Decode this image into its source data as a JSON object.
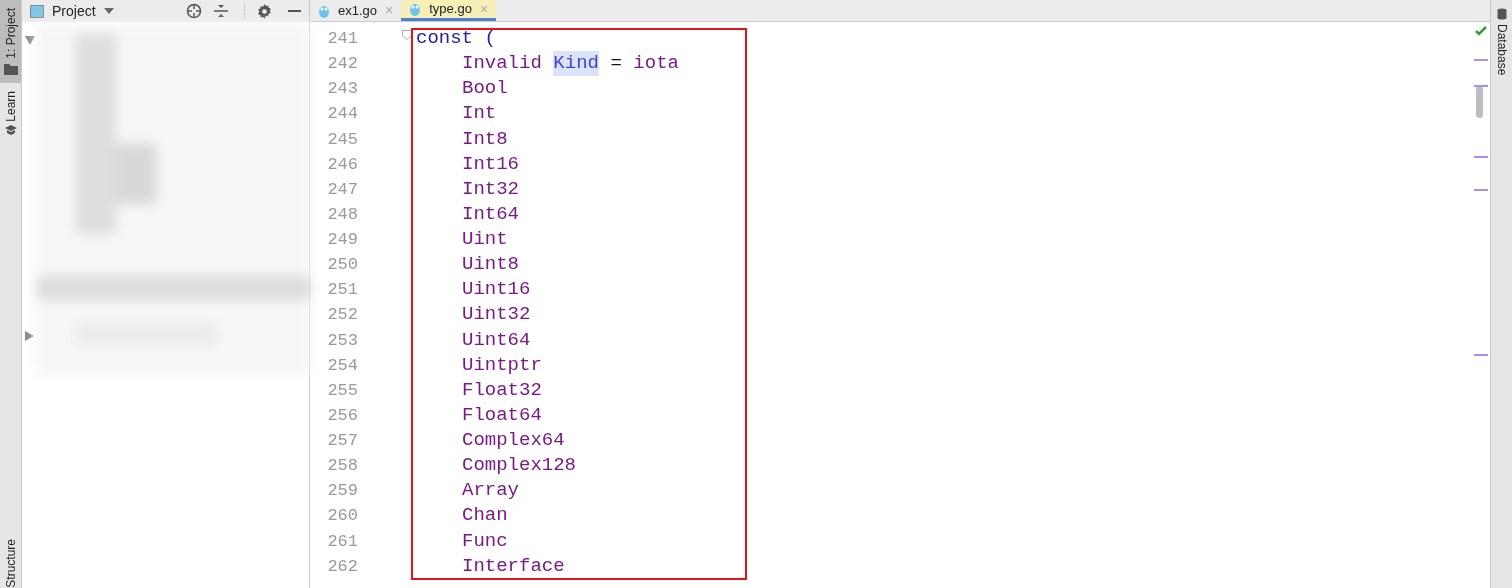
{
  "left_stripe": {
    "tabs": [
      {
        "label": "1: Project",
        "selected": true,
        "kind": "folder"
      },
      {
        "label": "Learn",
        "selected": false,
        "kind": "learn"
      }
    ],
    "bottom_tabs": [
      {
        "label": "Structure",
        "selected": false
      }
    ]
  },
  "project_panel": {
    "title": "Project",
    "tree_nodes": [
      {
        "expanded": true
      },
      {
        "expanded": false
      }
    ]
  },
  "editor_tabs": [
    {
      "label": "ex1.go",
      "close": "×",
      "selected": false
    },
    {
      "label": "type.go",
      "close": "×",
      "selected": true
    }
  ],
  "code": [
    {
      "number": "241",
      "segments": [
        {
          "text": "const (",
          "kind": "keyword"
        }
      ],
      "children": [
        {
          "number": "242",
          "segments": [
            {
              "text": "Invalid",
              "kind": "constant"
            },
            {
              "text": "Kind",
              "kind": "highlighted"
            },
            {
              "text": "=",
              "kind": "plain"
            },
            {
              "text": "iota",
              "kind": "constant"
            }
          ]
        },
        {
          "number": "243",
          "segments": [
            {
              "text": "Bool",
              "kind": "constant"
            }
          ]
        },
        {
          "number": "244",
          "segments": [
            {
              "text": "Int",
              "kind": "constant"
            }
          ]
        },
        {
          "number": "245",
          "segments": [
            {
              "text": "Int8",
              "kind": "constant"
            }
          ]
        },
        {
          "number": "246",
          "segments": [
            {
              "text": "Int16",
              "kind": "constant"
            }
          ]
        },
        {
          "number": "247",
          "segments": [
            {
              "text": "Int32",
              "kind": "constant"
            }
          ]
        },
        {
          "number": "248",
          "segments": [
            {
              "text": "Int64",
              "kind": "constant"
            }
          ]
        },
        {
          "number": "249",
          "segments": [
            {
              "text": "Uint",
              "kind": "constant"
            }
          ]
        },
        {
          "number": "250",
          "segments": [
            {
              "text": "Uint8",
              "kind": "constant"
            }
          ]
        },
        {
          "number": "251",
          "segments": [
            {
              "text": "Uint16",
              "kind": "constant"
            }
          ]
        },
        {
          "number": "252",
          "segments": [
            {
              "text": "Uint32",
              "kind": "constant"
            }
          ]
        },
        {
          "number": "253",
          "segments": [
            {
              "text": "Uint64",
              "kind": "constant"
            }
          ]
        },
        {
          "number": "254",
          "segments": [
            {
              "text": "Uintptr",
              "kind": "constant"
            }
          ]
        },
        {
          "number": "255",
          "segments": [
            {
              "text": "Float32",
              "kind": "constant"
            }
          ]
        },
        {
          "number": "256",
          "segments": [
            {
              "text": "Float64",
              "kind": "constant"
            }
          ]
        },
        {
          "number": "257",
          "segments": [
            {
              "text": "Complex64",
              "kind": "constant"
            }
          ]
        },
        {
          "number": "258",
          "segments": [
            {
              "text": "Complex128",
              "kind": "constant"
            }
          ]
        },
        {
          "number": "259",
          "segments": [
            {
              "text": "Array",
              "kind": "constant"
            }
          ]
        },
        {
          "number": "260",
          "segments": [
            {
              "text": "Chan",
              "kind": "constant"
            }
          ]
        },
        {
          "number": "261",
          "segments": [
            {
              "text": "Func",
              "kind": "constant"
            }
          ]
        },
        {
          "number": "262",
          "segments": [
            {
              "text": "Interface",
              "kind": "constant"
            }
          ]
        }
      ]
    }
  ],
  "right_stripe": {
    "tabs": [
      {
        "label": "Database",
        "selected": false
      }
    ]
  }
}
